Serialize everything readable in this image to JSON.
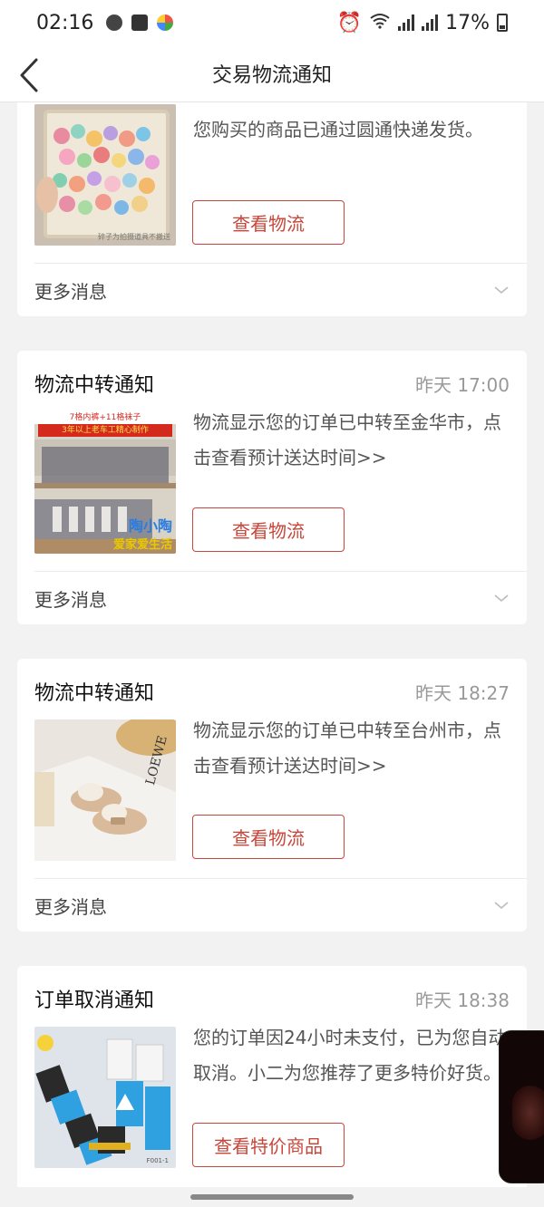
{
  "status_bar": {
    "time": "02:16",
    "battery": "17%"
  },
  "nav": {
    "title": "交易物流通知",
    "back_icon": "chevron-left-icon"
  },
  "cards": [
    {
      "title": "",
      "time": "",
      "message": "您购买的商品已通过圆通快递发货。",
      "button": "查看物流",
      "more": "更多消息",
      "thumb_caption": "碎子为拍摄道具不搬送"
    },
    {
      "title": "物流中转通知",
      "time": "昨天 17:00",
      "message": "物流显示您的订单已中转至金华市，点击查看预计送达时间>>",
      "button": "查看物流",
      "more": "更多消息",
      "thumb_banner1": "7格内裤+11格袜子",
      "thumb_banner2": "3年以上老车工精心制作",
      "thumb_brand1": "陶小陶",
      "thumb_brand2": "爱家爱生活"
    },
    {
      "title": "物流中转通知",
      "time": "昨天 18:27",
      "message": "物流显示您的订单已中转至台州市，点击查看预计送达时间>>",
      "button": "查看物流",
      "more": "更多消息",
      "thumb_text": "LOEWE"
    },
    {
      "title": "订单取消通知",
      "time": "昨天 18:38",
      "message": "您的订单因24小时未支付，已为您自动取消。小二为您推荐了更多特价好货。",
      "button": "查看特价商品",
      "thumb_code": "F001-1"
    }
  ],
  "colors": {
    "accent": "#c9463a",
    "page_bg": "#f2f2f2",
    "card_bg": "#ffffff"
  }
}
